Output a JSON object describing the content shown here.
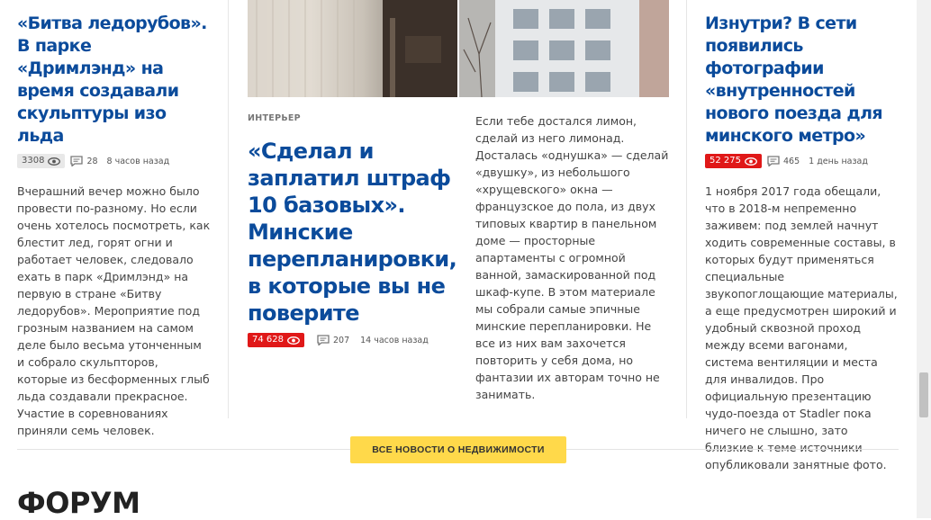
{
  "left_article": {
    "title": "«Битва ледорубов». В парке «Дримлэнд» на время создавали скульптуры изо льда",
    "views": "3308",
    "comments": "28",
    "time": "8 часов назад",
    "text": "Вчерашний вечер можно было провести по-разному. Но если очень хотелось посмотреть, как блестит лед, горят огни и работает человек, следовало ехать в парк «Дримлэнд» на первую в стране «Битву ледорубов». Мероприятие под грозным названием на самом деле было весьма утонченным и собрало скульпторов, которые из бесформенных глыб льда создавали прекрасное. Участие в соревнованиях приняли семь человек."
  },
  "mid_article": {
    "rubric": "ИНТЕРЬЕР",
    "title": "«Сделал и заплатил штраф 10 базовых». Минские перепланировки, в которые вы не поверите",
    "views": "74 628",
    "comments": "207",
    "time": "14 часов назад",
    "text": "Если тебе достался лимон, сделай из него лимонад. Досталась «однушка» — сделай «двушку», из небольшого «хрущевского» окна — французское до пола, из двух типовых квартир в панельном доме — просторные апартаменты с огромной ванной, замаскированной под шкаф-купе. В этом материале мы собрали самые эпичные минские перепланировки. Не все из них вам захочется повторить у себя дома, но фантазии их авторам точно не занимать."
  },
  "right_article": {
    "title": "Изнутри? В сети появились фотографии «внутренностей нового поезда для минского метро»",
    "views": "52 275",
    "comments": "465",
    "time": "1 день назад",
    "text": "1 ноября 2017 года обещали, что в 2018-м непременно заживем: под землей начнут ходить современные составы, в которых будут применяться специальные звукопоглощающие материалы, а еще предусмотрен широкий и удобный сквозной проход между всеми вагонами, система вентиляции и места для инвалидов. Про официальную презентацию чудо-поезда от Stadler пока ничего не слышно, зато близкие к теме источники опубликовали занятные фото."
  },
  "all_news_button": "ВСЕ НОВОСТИ О НЕДВИЖИМОСТИ",
  "forum_heading": "ФОРУМ",
  "colors": {
    "headline": "#0b4b9b",
    "views_hot": "#e01818",
    "button": "#ffd94a"
  },
  "icons": {
    "views": "eye-icon",
    "comments": "comment-icon"
  }
}
